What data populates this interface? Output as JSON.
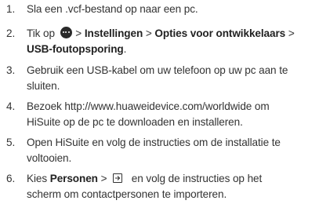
{
  "steps": [
    {
      "number": "1.",
      "line1": "Sla een .vcf-bestand op naar een pc."
    },
    {
      "number": "2.",
      "text_before_icon": "Tik op",
      "icon": "menu-icon",
      "sep1": ">",
      "bold1": "Instellingen",
      "sep2": ">",
      "bold2": "Opties voor ontwikkelaars",
      "sep3": ">",
      "bold3": "USB-foutopsporing",
      "end": "."
    },
    {
      "number": "3.",
      "line1": "Gebruik een USB-kabel om uw telefoon op uw pc aan te",
      "line2": "sluiten."
    },
    {
      "number": "4.",
      "line1": "Bezoek http://www.huaweidevice.com/worldwide om",
      "line2": "HiSuite op de pc te downloaden en installeren."
    },
    {
      "number": "5.",
      "line1": "Open HiSuite en volg de instructies om de installatie te",
      "line2": "voltooien."
    },
    {
      "number": "6.",
      "text_before": "Kies",
      "bold1": "Personen",
      "sep1": ">",
      "icon": "import-icon",
      "line1_after_icon": "en volg de instructies op het",
      "line2": "scherm om contactpersonen te importeren."
    }
  ]
}
